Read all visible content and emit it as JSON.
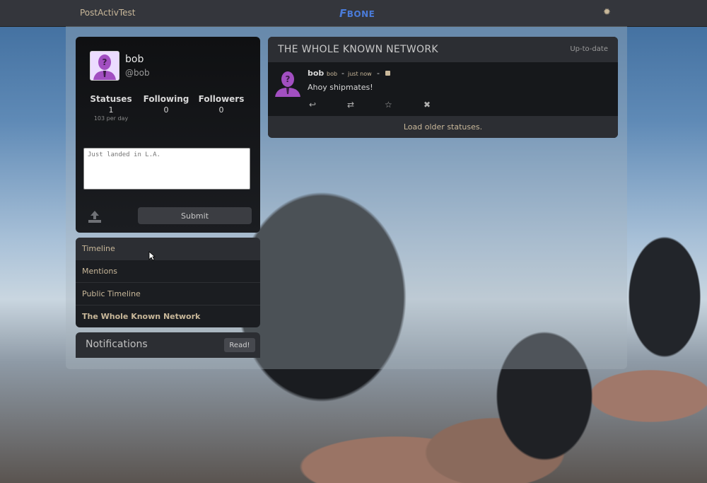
{
  "topbar": {
    "instance_name": "PostActivTest",
    "logo_f": "F",
    "logo_text": "BONE",
    "settings_icon": "gear-icon"
  },
  "user_card": {
    "name": "bob",
    "handle": "@bob",
    "stats": [
      {
        "label": "Statuses",
        "value": "1",
        "sub": "103 per day"
      },
      {
        "label": "Following",
        "value": "0",
        "sub": ""
      },
      {
        "label": "Followers",
        "value": "0",
        "sub": ""
      }
    ],
    "compose_placeholder": "Just landed in L.A.",
    "submit_label": "Submit",
    "upload_icon": "upload-icon"
  },
  "nav": {
    "items": [
      {
        "label": "Timeline"
      },
      {
        "label": "Mentions"
      },
      {
        "label": "Public Timeline"
      },
      {
        "label": "The Whole Known Network"
      }
    ]
  },
  "notifications": {
    "title": "Notifications",
    "read_label": "Read!"
  },
  "timeline": {
    "title": "THE WHOLE KNOWN NETWORK",
    "status": "Up-to-date",
    "statuses": [
      {
        "name": "bob",
        "handle": "bob",
        "separator": "-",
        "time": "just now",
        "text": "Ahoy shipmates!",
        "actions": [
          "reply-icon",
          "repeat-icon",
          "favorite-icon",
          "delete-icon"
        ]
      }
    ],
    "load_older": "Load older statuses."
  },
  "colors": {
    "accent": "#c9b89a",
    "panel": "#1b1d21",
    "header": "#2c2e33",
    "topbar": "#34363c"
  }
}
